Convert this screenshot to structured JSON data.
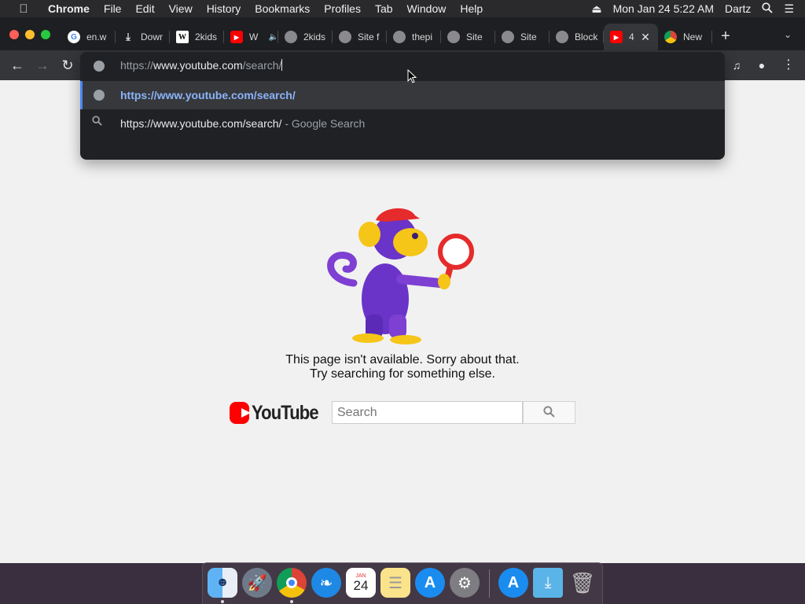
{
  "menubar": {
    "apple_icon": "apple-icon",
    "app_name": "Chrome",
    "menus": [
      "File",
      "Edit",
      "View",
      "History",
      "Bookmarks",
      "Profiles",
      "Tab",
      "Window",
      "Help"
    ],
    "datetime": "Mon Jan 24  5:22 AM",
    "user": "Dartz"
  },
  "tabs": [
    {
      "title": "en.w",
      "icon": "google-icon"
    },
    {
      "title": "Dowr",
      "icon": "download-icon"
    },
    {
      "title": "2kids",
      "icon": "wikipedia-icon"
    },
    {
      "title": "W",
      "icon": "youtube-icon",
      "audio": true
    },
    {
      "title": "2kids",
      "icon": "globe-icon"
    },
    {
      "title": "Site f",
      "icon": "globe-icon"
    },
    {
      "title": "thepi",
      "icon": "globe-icon"
    },
    {
      "title": "Site",
      "icon": "globe-icon"
    },
    {
      "title": "Site",
      "icon": "globe-icon"
    },
    {
      "title": "Block",
      "icon": "globe-icon"
    },
    {
      "title": "4",
      "icon": "youtube-icon",
      "active": true
    },
    {
      "title": "New",
      "icon": "chrome-icon"
    }
  ],
  "omnibox": {
    "url_scheme": "https://",
    "url_host": "www.youtube.com",
    "url_path": "/search/",
    "suggestions": {
      "first": "https://www.youtube.com/search/",
      "second_query": "https://www.youtube.com/search/",
      "second_suffix": " - Google Search"
    }
  },
  "page": {
    "error_line1": "This page isn't available. Sorry about that.",
    "error_line2": "Try searching for something else.",
    "logo_text": "YouTube",
    "search_placeholder": "Search"
  },
  "dock": [
    "finder-icon",
    "launchpad-icon",
    "chrome-icon",
    "safari-icon",
    "calendar-icon",
    "notes-icon",
    "app-store-icon",
    "system-preferences-icon",
    "app-store-downloads-icon",
    "downloads-folder-icon",
    "trash-icon"
  ],
  "dock_calendar": {
    "month": "JAN",
    "day": "24"
  },
  "colors": {
    "youtube_red": "#ff0000",
    "omnibox_highlight": "#8ab4f8"
  }
}
